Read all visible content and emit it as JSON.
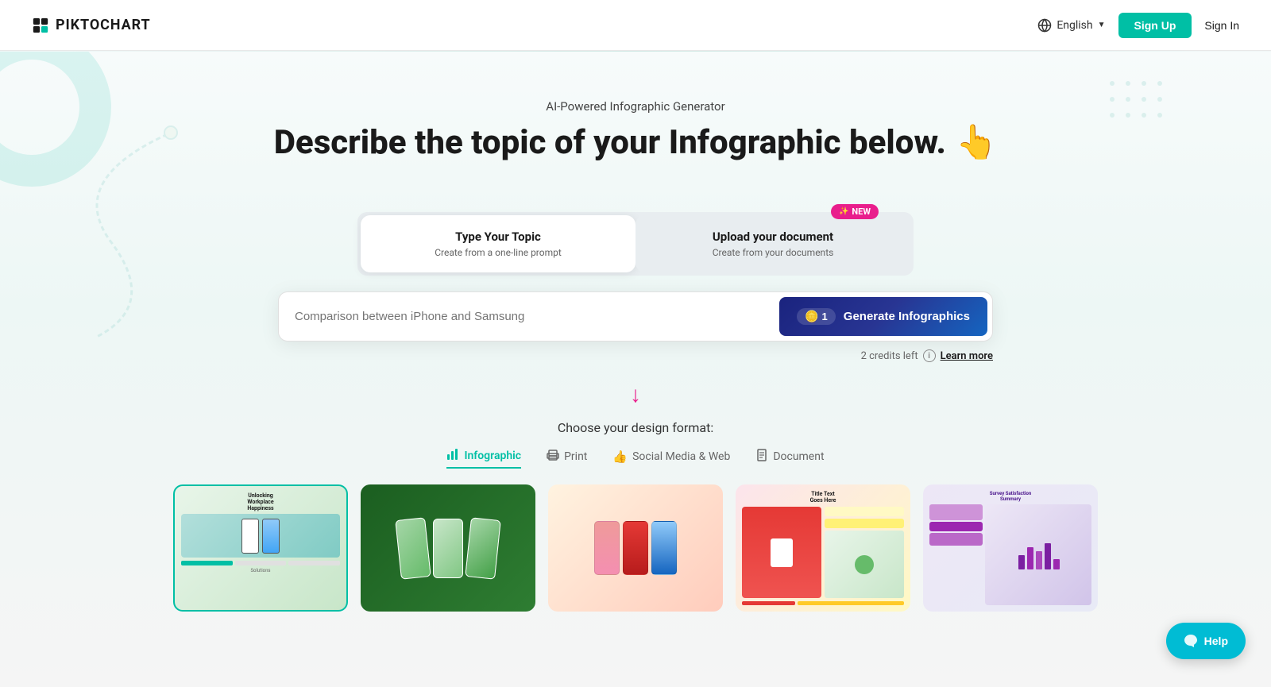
{
  "app": {
    "name": "PIKTOCHART"
  },
  "header": {
    "logo_text": "PIKTOCHART",
    "lang_label": "English",
    "signup_label": "Sign Up",
    "signin_label": "Sign In"
  },
  "hero": {
    "subtitle": "AI-Powered Infographic Generator",
    "title": "Describe the topic of your Infographic below.",
    "emoji": "👆"
  },
  "tabs": {
    "tab1": {
      "label": "Type Your Topic",
      "desc": "Create from a one-line prompt"
    },
    "tab2": {
      "label": "Upload your document",
      "desc": "Create from your documents",
      "badge": "NEW"
    }
  },
  "input": {
    "placeholder": "Comparison between iPhone and Samsung"
  },
  "generate_btn": {
    "credits_count": "1",
    "label": "Generate Infographics"
  },
  "credits": {
    "text": "2 credits left",
    "learn_more": "Learn more"
  },
  "design_format": {
    "title": "Choose your design format:",
    "tabs": [
      {
        "label": "Infographic",
        "icon": "📊",
        "active": true
      },
      {
        "label": "Print",
        "icon": "🖨️",
        "active": false
      },
      {
        "label": "Social Media & Web",
        "icon": "👍",
        "active": false
      },
      {
        "label": "Document",
        "icon": "📄",
        "active": false
      }
    ]
  },
  "help": {
    "label": "Help"
  },
  "templates": [
    {
      "id": 1,
      "style": "workplace",
      "selected": true
    },
    {
      "id": 2,
      "style": "dark-phones",
      "selected": false
    },
    {
      "id": 3,
      "style": "colorful-phones",
      "selected": false
    },
    {
      "id": 4,
      "style": "yellow-red",
      "selected": false
    },
    {
      "id": 5,
      "style": "purple-chart",
      "selected": false
    }
  ]
}
